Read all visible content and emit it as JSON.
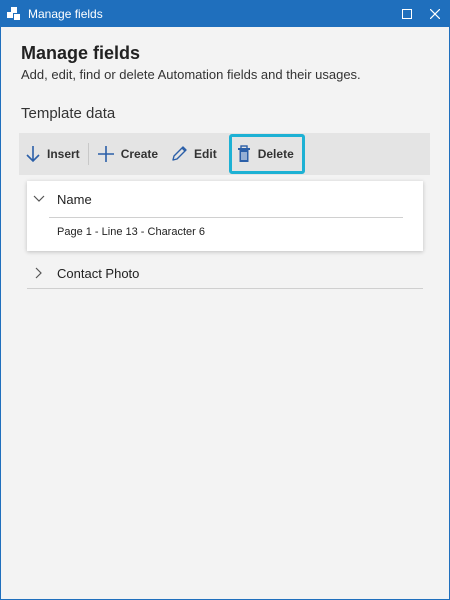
{
  "window": {
    "title": "Manage fields"
  },
  "header": {
    "title": "Manage fields",
    "subtitle": "Add, edit, find or delete Automation fields and their usages."
  },
  "section": {
    "title": "Template data"
  },
  "toolbar": {
    "insert_label": "Insert",
    "create_label": "Create",
    "edit_label": "Edit",
    "delete_label": "Delete"
  },
  "fields": [
    {
      "name": "Name",
      "expanded": true,
      "usages": [
        "Page 1 - Line 13 - Character 6"
      ]
    },
    {
      "name": "Contact Photo",
      "expanded": false,
      "usages": []
    }
  ],
  "colors": {
    "titlebar": "#1f6fbd",
    "focus_ring": "#1db1d4",
    "icon_blue": "#2b5fa8"
  }
}
